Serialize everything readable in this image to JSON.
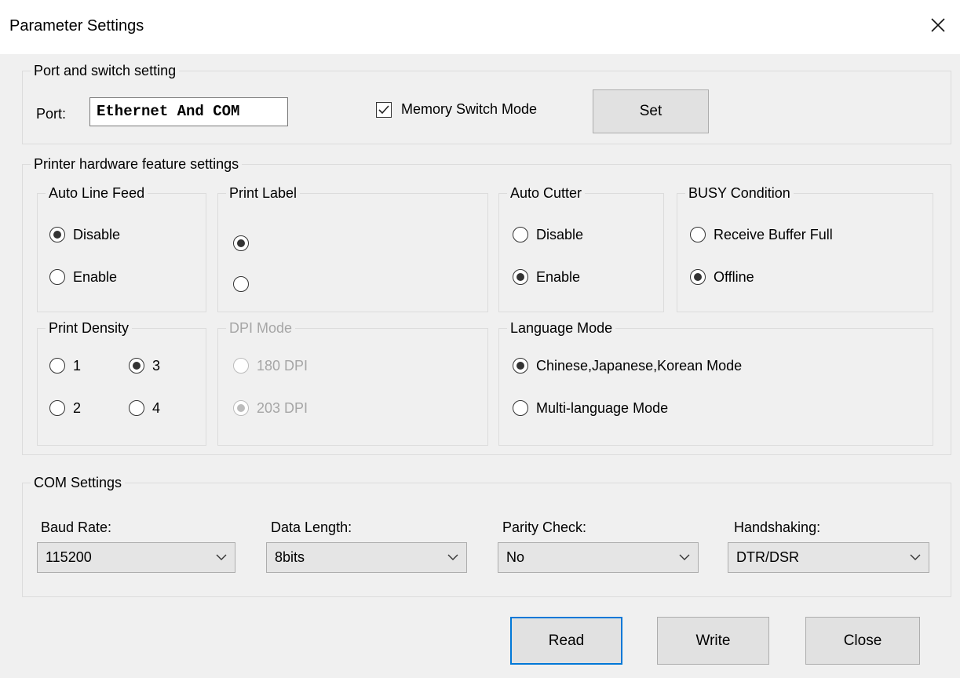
{
  "window": {
    "title": "Parameter Settings",
    "close_glyph": "✕"
  },
  "port_group": {
    "legend": "Port and switch setting",
    "port_label": "Port:",
    "port_value": "Ethernet And COM",
    "memory_switch_label": "Memory Switch Mode",
    "memory_switch_checked": true,
    "set_button": "Set"
  },
  "hardware_group": {
    "legend": "Printer hardware feature settings",
    "auto_line_feed": {
      "legend": "Auto Line Feed",
      "options": [
        "Disable",
        "Enable"
      ],
      "selected": "Disable"
    },
    "print_label": {
      "legend": "Print Label",
      "options": [
        "",
        ""
      ],
      "selected_index": 0
    },
    "auto_cutter": {
      "legend": "Auto Cutter",
      "options": [
        "Disable",
        "Enable"
      ],
      "selected": "Enable"
    },
    "busy_condition": {
      "legend": "BUSY Condition",
      "options": [
        "Receive Buffer Full",
        "Offline"
      ],
      "selected": "Offline"
    },
    "print_density": {
      "legend": "Print Density",
      "options": [
        "1",
        "2",
        "3",
        "4"
      ],
      "selected": "3"
    },
    "dpi_mode": {
      "legend": "DPI Mode",
      "options": [
        "180 DPI",
        "203 DPI"
      ],
      "selected": "203 DPI",
      "disabled": true
    },
    "language_mode": {
      "legend": "Language Mode",
      "options": [
        "Chinese,Japanese,Korean Mode",
        "Multi-language Mode"
      ],
      "selected": "Chinese,Japanese,Korean Mode"
    }
  },
  "com_group": {
    "legend": "COM Settings",
    "baud_rate": {
      "label": "Baud Rate:",
      "value": "115200"
    },
    "data_length": {
      "label": "Data Length:",
      "value": "8bits"
    },
    "parity_check": {
      "label": "Parity Check:",
      "value": "No"
    },
    "handshaking": {
      "label": "Handshaking:",
      "value": "DTR/DSR"
    }
  },
  "buttons": {
    "read": "Read",
    "write": "Write",
    "close": "Close"
  },
  "colors": {
    "focus_border": "#0078d7",
    "disabled_text": "#a6a6a6",
    "background": "#f0f0f0"
  }
}
